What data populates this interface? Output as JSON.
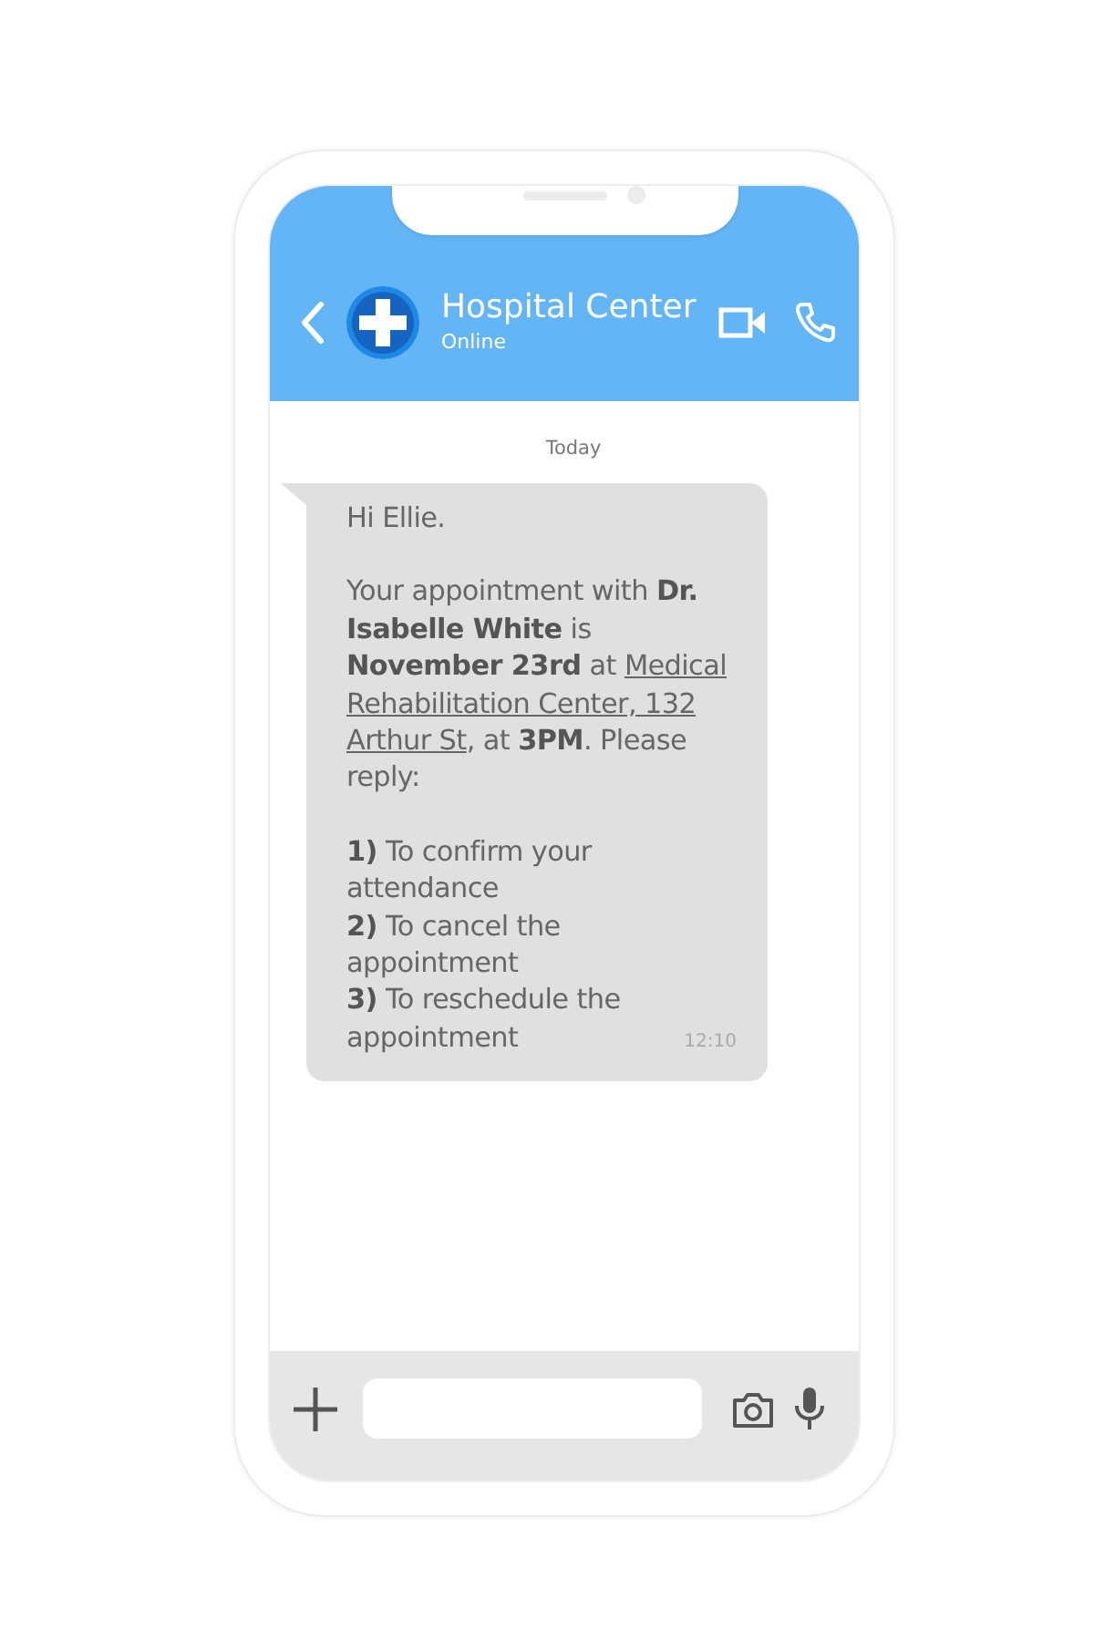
{
  "header": {
    "title": "Hospital Center",
    "status": "Online"
  },
  "date_divider": "Today",
  "messages": [
    {
      "time": "12:10",
      "paragraphs": [
        {
          "lines": [
            [
              {
                "kind": "text",
                "text": "Hi Ellie."
              }
            ]
          ]
        },
        {
          "lines": [
            [
              {
                "kind": "text",
                "text": "Your appointment with **Dr. Isabelle White** is **November 23rd** at "
              },
              {
                "kind": "underlined",
                "text": "Medical Rehabilitation Center, 132 Arthur St"
              },
              {
                "kind": "text",
                "text": ", at **3PM**. Please reply:"
              }
            ]
          ]
        },
        {
          "lines": [
            [
              {
                "kind": "text",
                "text": "**1)** To confirm your attendance"
              }
            ],
            [
              {
                "kind": "text",
                "text": "**2)** To cancel the appointment"
              }
            ],
            [
              {
                "kind": "text",
                "text": "**3)** To reschedule the appointment"
              }
            ]
          ]
        }
      ]
    }
  ]
}
